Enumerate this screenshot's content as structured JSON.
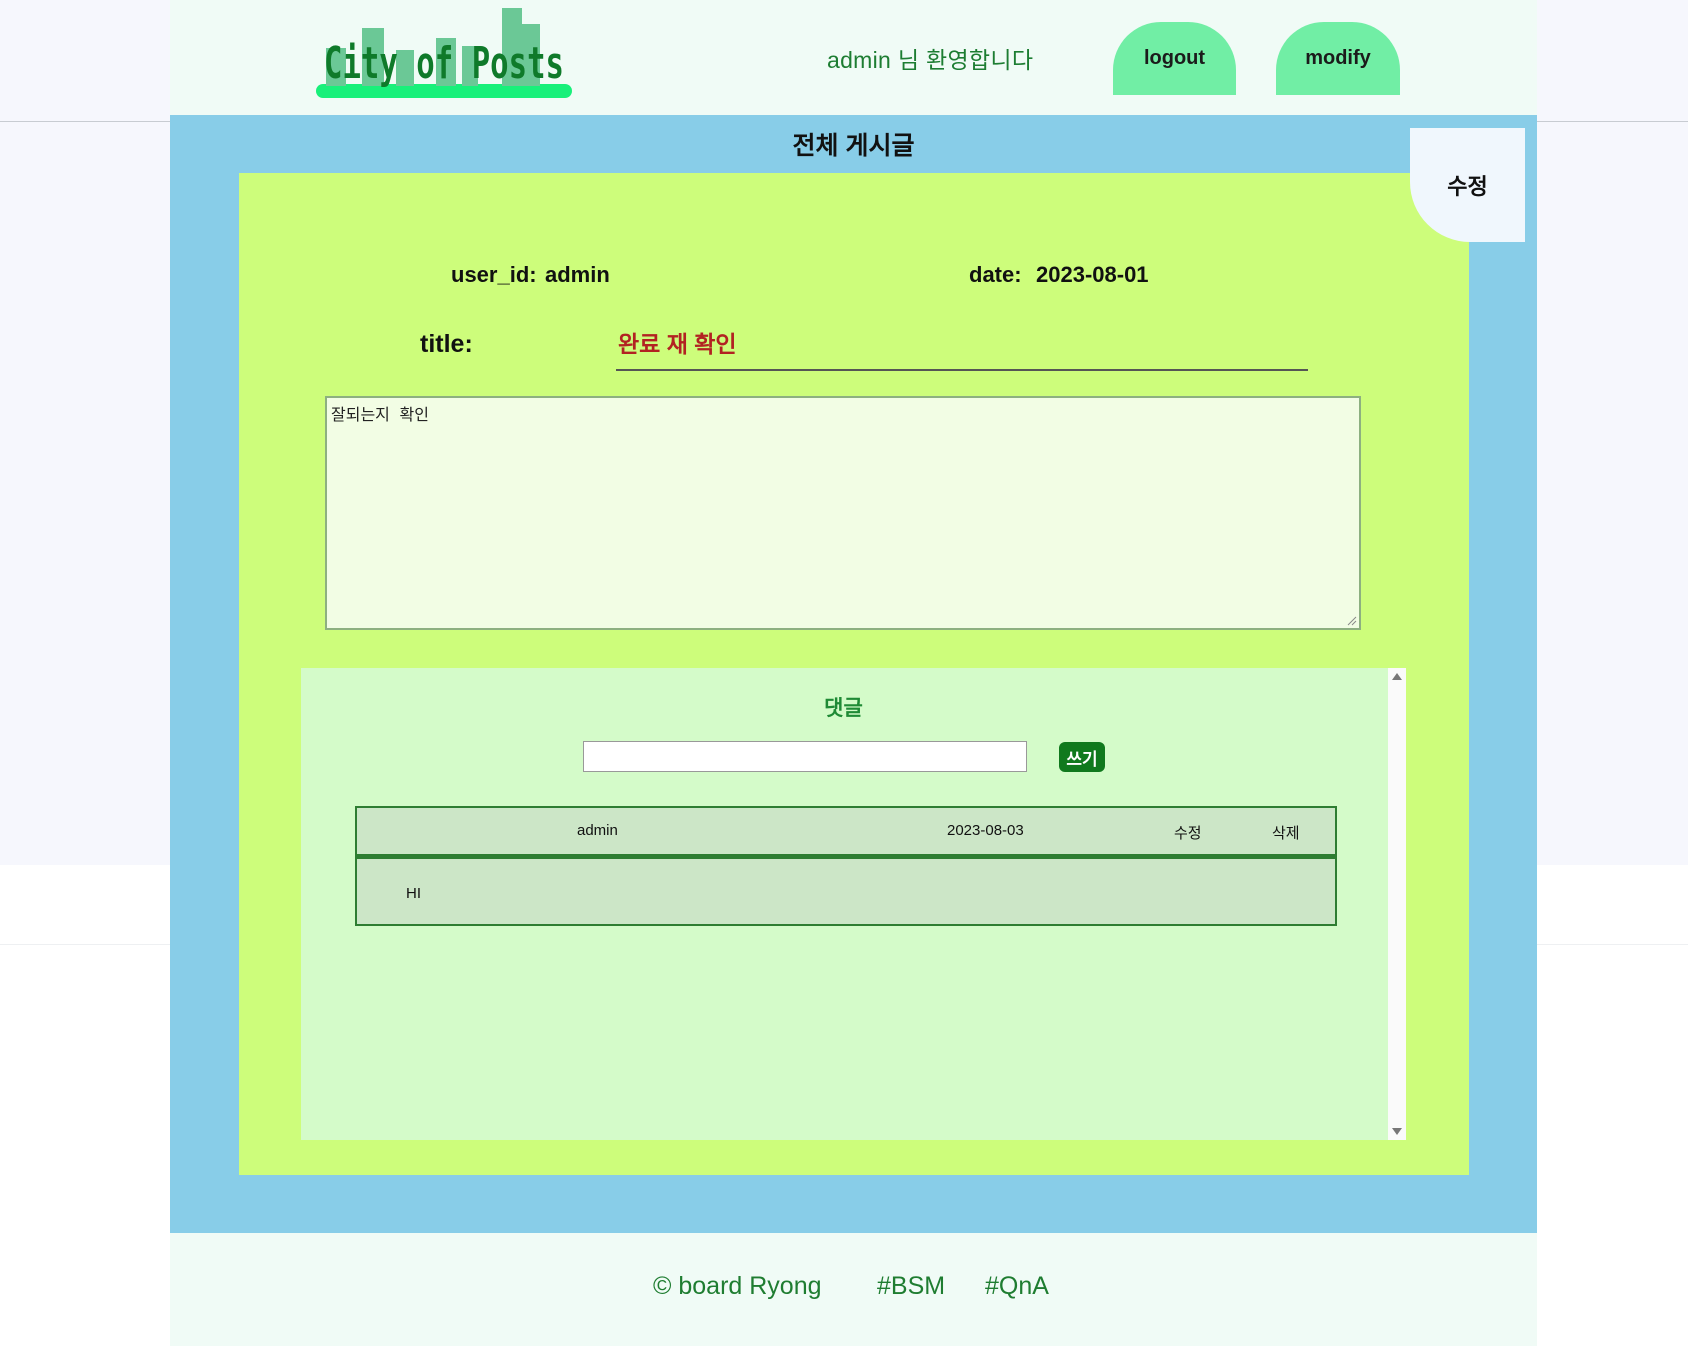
{
  "header": {
    "logo_text": "City of Posts",
    "welcome": "admin 님 환영합니다",
    "logout_label": "logout",
    "modify_label": "modify"
  },
  "board": {
    "title": "전체 게시글",
    "edit_tab_label": "수정"
  },
  "post": {
    "user_id_label": "user_id:",
    "user_id_value": "admin",
    "date_label": "date:",
    "date_value": "2023-08-01",
    "title_label": "title:",
    "title_value": "완료 재 확인",
    "content": "잘되는지 확인"
  },
  "comments": {
    "heading": "댓글",
    "input_value": "",
    "write_label": "쓰기",
    "items": [
      {
        "author": "admin",
        "date": "2023-08-03",
        "edit_label": "수정",
        "delete_label": "삭제",
        "text": "HI"
      }
    ]
  },
  "footer": {
    "copyright": "© board Ryong",
    "tag1": "#BSM",
    "tag2": "#QnA"
  },
  "colors": {
    "panel_blue": "#88cde8",
    "card_green": "#cdfd7b",
    "button_mint": "#71eea5",
    "accent_dark_green": "#10791d",
    "title_red": "#b22222"
  }
}
